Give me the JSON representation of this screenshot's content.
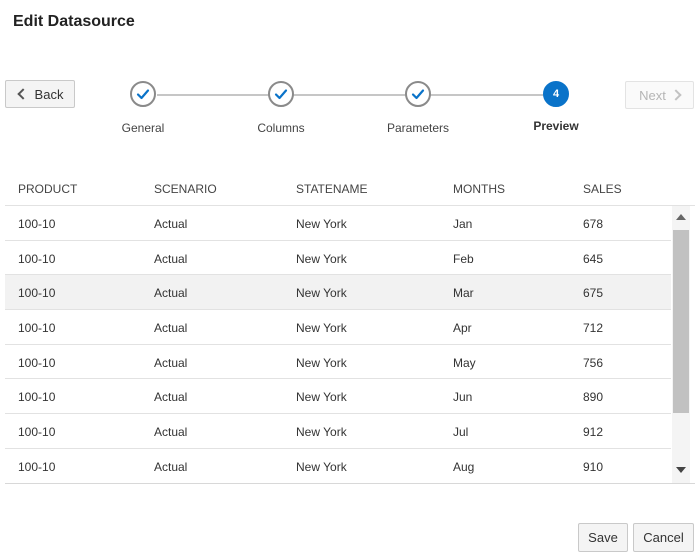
{
  "dialog": {
    "title": "Edit Datasource"
  },
  "nav": {
    "back_label": "Back",
    "next_label": "Next"
  },
  "steps": [
    {
      "label": "General",
      "state": "complete",
      "icon": "checkmark-icon"
    },
    {
      "label": "Columns",
      "state": "complete",
      "icon": "checkmark-icon"
    },
    {
      "label": "Parameters",
      "state": "complete",
      "icon": "checkmark-icon"
    },
    {
      "label": "Preview",
      "state": "current",
      "number": "4"
    }
  ],
  "table": {
    "columns": [
      "PRODUCT",
      "SCENARIO",
      "STATENAME",
      "MONTHS",
      "SALES"
    ],
    "rows": [
      [
        "100-10",
        "Actual",
        "New York",
        "Jan",
        "678"
      ],
      [
        "100-10",
        "Actual",
        "New York",
        "Feb",
        "645"
      ],
      [
        "100-10",
        "Actual",
        "New York",
        "Mar",
        "675"
      ],
      [
        "100-10",
        "Actual",
        "New York",
        "Apr",
        "712"
      ],
      [
        "100-10",
        "Actual",
        "New York",
        "May",
        "756"
      ],
      [
        "100-10",
        "Actual",
        "New York",
        "Jun",
        "890"
      ],
      [
        "100-10",
        "Actual",
        "New York",
        "Jul",
        "912"
      ],
      [
        "100-10",
        "Actual",
        "New York",
        "Aug",
        "910"
      ]
    ]
  },
  "footer": {
    "save_label": "Save",
    "cancel_label": "Cancel"
  },
  "colors": {
    "accent": "#0a73c9",
    "row_highlight": "#f2f2f2"
  }
}
